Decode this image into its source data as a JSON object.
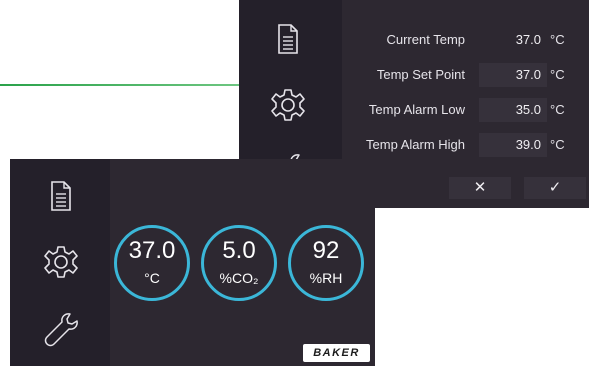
{
  "settings": {
    "sidebar_icons": [
      "document-icon",
      "gear-icon",
      "wrench-icon"
    ],
    "rows": [
      {
        "label": "Current Temp",
        "value": "37.0",
        "unit": "°C"
      },
      {
        "label": "Temp Set Point",
        "value": "37.0",
        "unit": "°C"
      },
      {
        "label": "Temp Alarm Low",
        "value": "35.0",
        "unit": "°C"
      },
      {
        "label": "Temp Alarm High",
        "value": "39.0",
        "unit": "°C"
      }
    ],
    "cancel_label": "✕",
    "confirm_label": "✓"
  },
  "main": {
    "sidebar_icons": [
      "document-icon",
      "gear-icon",
      "wrench-icon"
    ],
    "gauges": [
      {
        "value": "37.0",
        "unit": "°C"
      },
      {
        "value": "5.0",
        "unit": "%CO₂"
      },
      {
        "value": "92",
        "unit": "%RH"
      }
    ],
    "logo_text": "BAKER"
  },
  "colors": {
    "panel_bg": "#2d2831",
    "sidebar_bg": "#24202a",
    "gauge_ring": "#3bb7d8",
    "divider_line": "#2aa24a"
  }
}
